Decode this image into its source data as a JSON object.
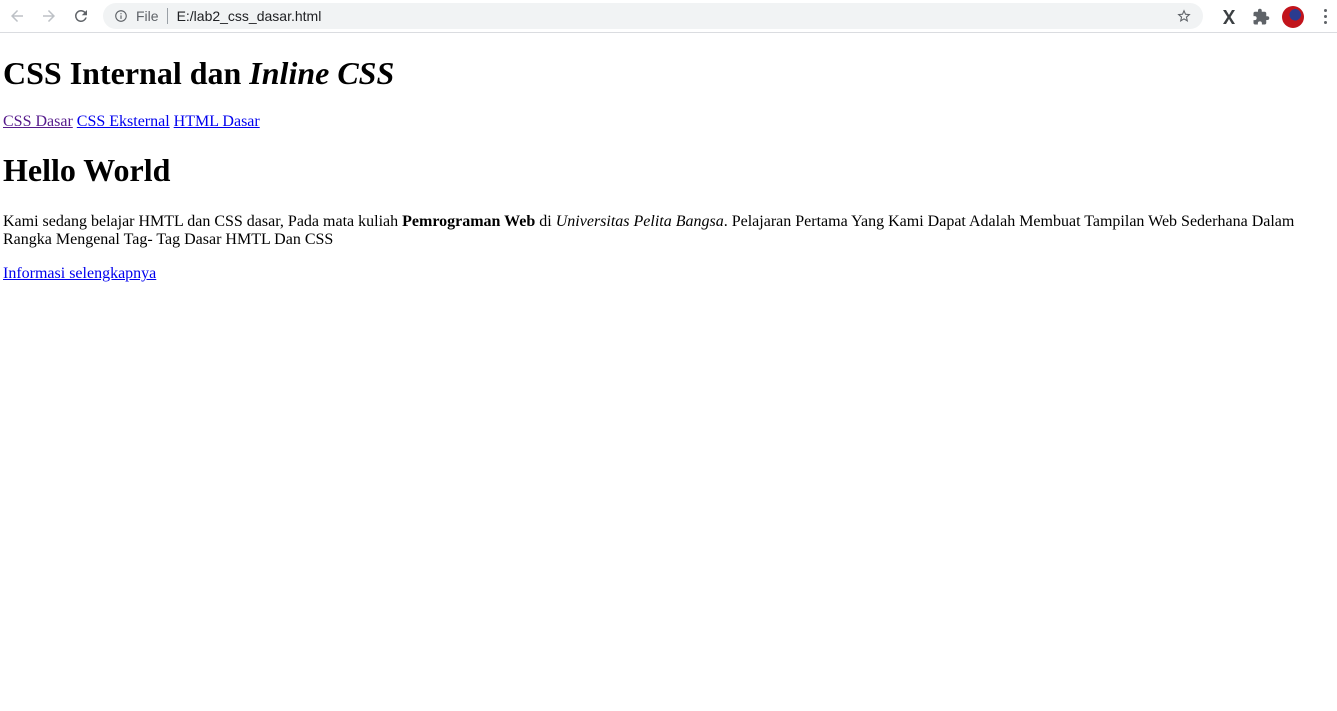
{
  "browser": {
    "scheme_label": "File",
    "url": "E:/lab2_css_dasar.html"
  },
  "page": {
    "title_plain": "CSS Internal dan ",
    "title_italic": "Inline CSS",
    "nav_links": [
      "CSS Dasar",
      "CSS Eksternal",
      "HTML Dasar"
    ],
    "heading": "Hello World",
    "paragraph": {
      "part1": "Kami sedang belajar HMTL dan CSS dasar, Pada mata kuliah ",
      "bold": "Pemrograman Web",
      "part2": " di ",
      "italic": "Universitas Pelita Bangsa",
      "part3": ". Pelajaran Pertama Yang Kami Dapat Adalah Membuat Tampilan Web Sederhana Dalam Rangka Mengenal Tag- Tag Dasar HMTL Dan CSS"
    },
    "more_link": "Informasi selengkapnya"
  },
  "colors": {
    "link": "#0000ee",
    "visited_link": "#551a8b",
    "omnibox_bg": "#f1f3f4"
  }
}
